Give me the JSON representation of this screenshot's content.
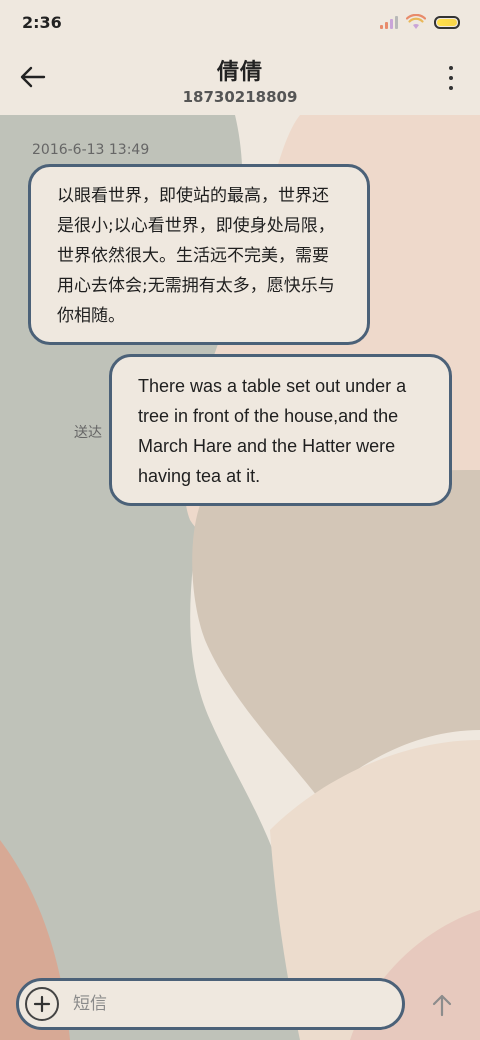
{
  "status_bar": {
    "time": "2:36",
    "icons": [
      "signal-icon",
      "wifi-icon",
      "battery-icon"
    ]
  },
  "header": {
    "title": "倩倩",
    "phone": "18730218809"
  },
  "messages": {
    "timestamp": "2016-6-13 13:49",
    "incoming_text": "以眼看世界，即使站的最高，世界还是很小;以心看世界，即使身处局限，世界依然很大。生活远不完美，需要用心去体会;无需拥有太多，愿快乐与你相随。",
    "outgoing_text": "There was a table set out under a tree in front of the house,and the March Hare and the Hatter were having tea at it.",
    "outgoing_status": "送达"
  },
  "composer": {
    "placeholder": "短信",
    "value": ""
  },
  "colors": {
    "bubble_border": "#4b6178",
    "bubble_fill": "#efe8df",
    "background": "#efe8df",
    "shape_sage": "#bdc1b8",
    "shape_taupe": "#d2c5b6",
    "shape_pink": "#e6c8bc"
  }
}
